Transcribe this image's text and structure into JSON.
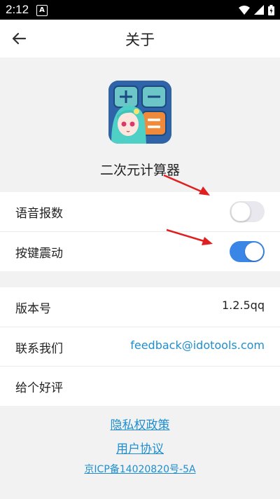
{
  "status_bar": {
    "time": "2:12",
    "notification_letter": "A"
  },
  "header": {
    "title": "关于"
  },
  "app": {
    "name": "二次元计算器",
    "icon": "calculator-anime-app-icon"
  },
  "settings": {
    "voice_label": "语音报数",
    "voice_on": false,
    "vibrate_label": "按键震动",
    "vibrate_on": true
  },
  "info": {
    "version_label": "版本号",
    "version_value": "1.2.5qq",
    "contact_label": "联系我们",
    "contact_value": "feedback@idotools.com",
    "rate_label": "给个好评"
  },
  "footer": {
    "privacy_link": "隐私权政策",
    "agreement_link": "用户协议",
    "icp": "京ICP备14020820号-5A"
  },
  "colors": {
    "accent": "#3a86e6",
    "link": "#1f8ed0",
    "annotation_arrow": "#e02020"
  }
}
